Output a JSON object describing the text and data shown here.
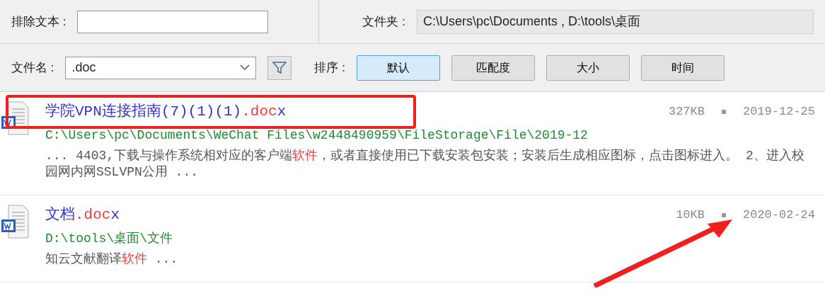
{
  "filters": {
    "exclude_label": "排除文本 :",
    "folder_label": "文件夹 :",
    "folder_value": "C:\\Users\\pc\\Documents , D:\\tools\\桌面"
  },
  "toolbar": {
    "filename_label": "文件名 :",
    "filename_value": ".doc",
    "sort_label": "排序 :",
    "sort_buttons": [
      {
        "label": "默认",
        "selected": true
      },
      {
        "label": "匹配度",
        "selected": false
      },
      {
        "label": "大小",
        "selected": false
      },
      {
        "label": "时间",
        "selected": false
      }
    ]
  },
  "results": [
    {
      "name": [
        {
          "text": "学院VPN连接指南(7)(1)(1)",
          "match": false
        },
        {
          "text": ".doc",
          "match": true
        },
        {
          "text": "x",
          "match": false
        }
      ],
      "size": "327KB",
      "date": "2019-12-25",
      "path": "C:\\Users\\pc\\Documents\\WeChat Files\\w2448490959\\FileStorage\\File\\2019-12",
      "snippet": [
        {
          "text": "... 4403,下载与操作系统相对应的客户端",
          "match": false
        },
        {
          "text": "软件",
          "match": true
        },
        {
          "text": "，或者直接使用已下载安装包安装；安装后生成相应图标，点击图标进入。 2、进入校园网内网SSLVPN公用 ...",
          "match": false
        }
      ],
      "highlighted": true,
      "arrow": false
    },
    {
      "name": [
        {
          "text": "文档",
          "match": false
        },
        {
          "text": ".doc",
          "match": true
        },
        {
          "text": "x",
          "match": false
        }
      ],
      "size": "10KB",
      "date": "2020-02-24",
      "path": "D:\\tools\\桌面\\文件",
      "snippet": [
        {
          "text": "知云文献翻译",
          "match": false
        },
        {
          "text": "软件",
          "match": true
        },
        {
          "text": " ...",
          "match": false
        }
      ],
      "highlighted": false,
      "arrow": true
    }
  ]
}
